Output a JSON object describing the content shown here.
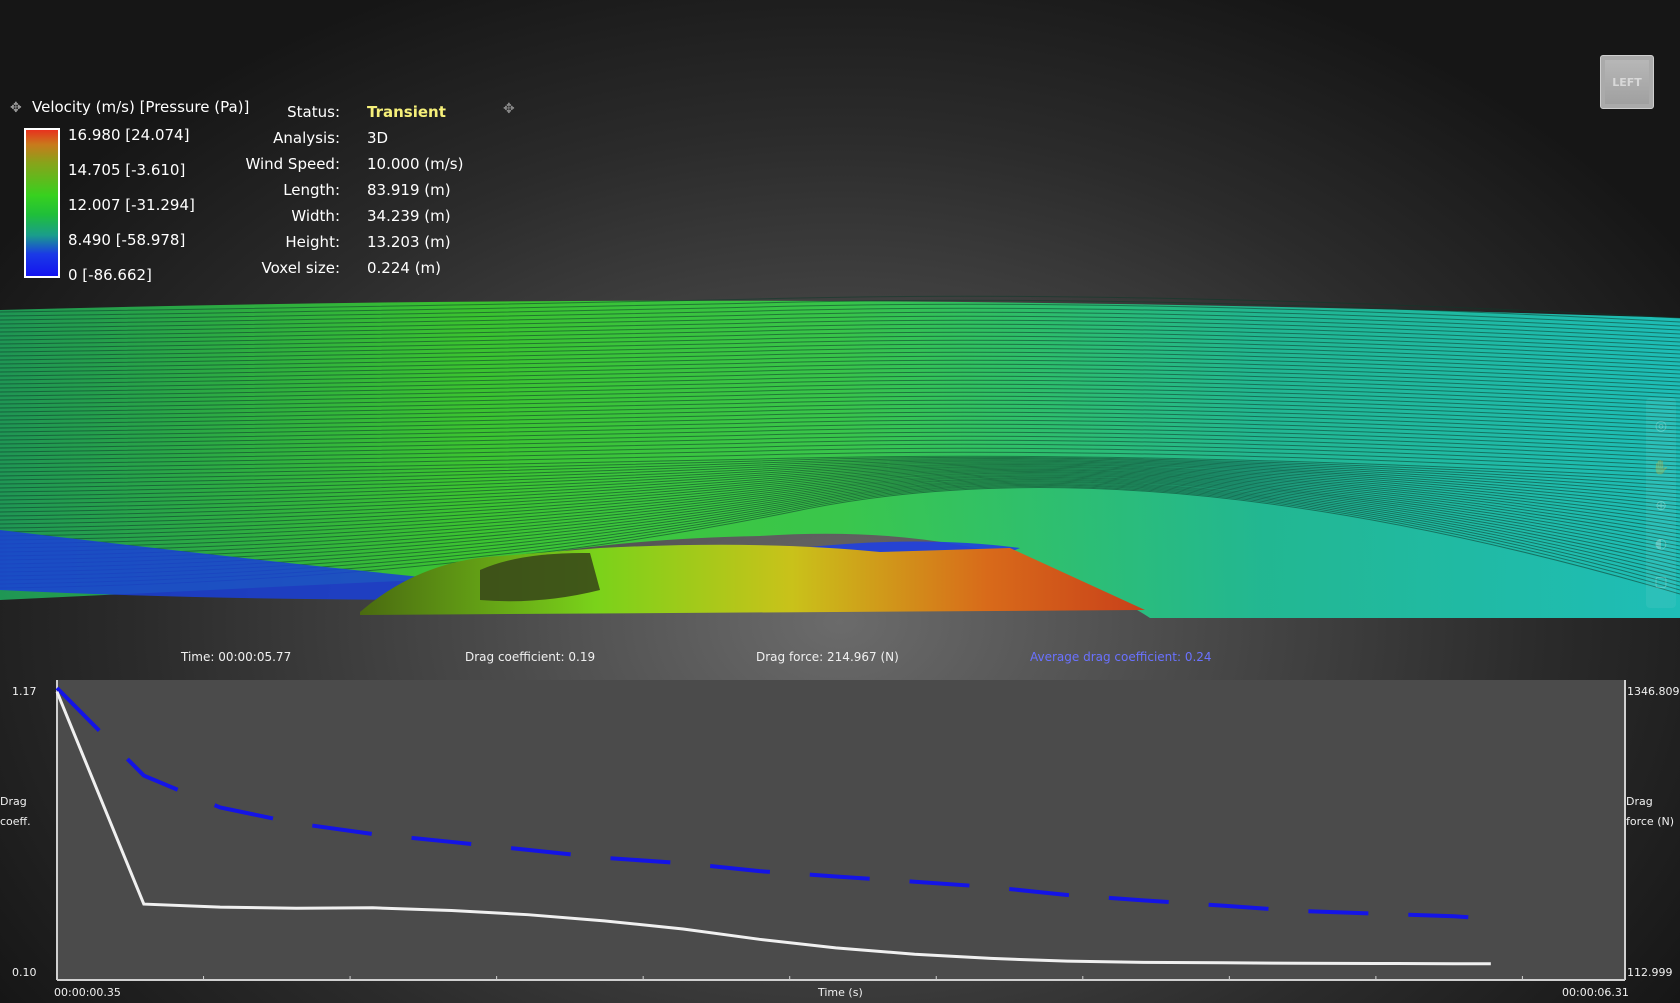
{
  "legend": {
    "title": "Velocity (m/s) [Pressure (Pa)]",
    "move_icon": "move-icon",
    "labels": [
      "16.980 [24.074]",
      "14.705 [-3.610]",
      "12.007 [-31.294]",
      "8.490 [-58.978]",
      "0 [-86.662]"
    ]
  },
  "info": [
    {
      "key": "Status:",
      "value": "Transient"
    },
    {
      "key": "Analysis:",
      "value": "3D"
    },
    {
      "key": "Wind Speed:",
      "value": "10.000 (m/s)"
    },
    {
      "key": "Length:",
      "value": "83.919 (m)"
    },
    {
      "key": "Width:",
      "value": "34.239 (m)"
    },
    {
      "key": "Height:",
      "value": "13.203 (m)"
    },
    {
      "key": "Voxel size:",
      "value": "0.224 (m)"
    }
  ],
  "view_cube": {
    "label": "LEFT"
  },
  "colors": {
    "status": "#f6f07a",
    "avg_readout": "#6a72ff",
    "drag_coeff_line": "#1414e6",
    "drag_force_line": "#f0f0f0"
  },
  "readouts": {
    "time": "Time: 00:00:05.77",
    "drag_coefficient": "Drag coefficient: 0.19",
    "drag_force": "Drag force: 214.967 (N)",
    "avg_drag_coefficient": "Average drag coefficient: 0.24"
  },
  "chart_data": {
    "type": "line",
    "xlabel": "Time (s)",
    "x_start_label": "00:00:00.35",
    "x_end_label": "00:00:06.31",
    "x_range": [
      0.35,
      6.31
    ],
    "y_left": {
      "label_line1": "Drag",
      "label_line2": "coeff.",
      "max_label": "1.17",
      "min_label": "0.10",
      "range": [
        0.1,
        1.17
      ]
    },
    "y_right": {
      "label_line1": "Drag",
      "label_line2": "force (N)",
      "max_label": "1346.809",
      "min_label": "112.999",
      "range": [
        112.999,
        1346.809
      ]
    },
    "series": [
      {
        "style": "dashed",
        "x": [
          0.35,
          0.68,
          0.97,
          1.26,
          1.55,
          1.85,
          2.14,
          2.43,
          2.73,
          3.02,
          3.31,
          3.61,
          3.9,
          4.19,
          4.48,
          4.78,
          5.07,
          5.36,
          5.66,
          5.8
        ],
        "y": [
          1.17,
          0.84,
          0.72,
          0.66,
          0.62,
          0.59,
          0.56,
          0.53,
          0.51,
          0.48,
          0.46,
          0.44,
          0.42,
          0.39,
          0.37,
          0.35,
          0.33,
          0.32,
          0.31,
          0.3
        ]
      },
      {
        "style": "solid",
        "x": [
          0.35,
          0.68,
          0.97,
          1.26,
          1.55,
          1.85,
          2.14,
          2.43,
          2.73,
          3.02,
          3.31,
          3.61,
          3.9,
          4.19,
          4.48,
          4.78,
          5.07,
          5.36,
          5.66,
          5.8
        ],
        "y": [
          1330,
          408,
          395,
          390,
          392,
          380,
          362,
          335,
          300,
          255,
          218,
          190,
          172,
          160,
          155,
          153,
          151,
          150,
          149,
          149
        ]
      }
    ]
  }
}
